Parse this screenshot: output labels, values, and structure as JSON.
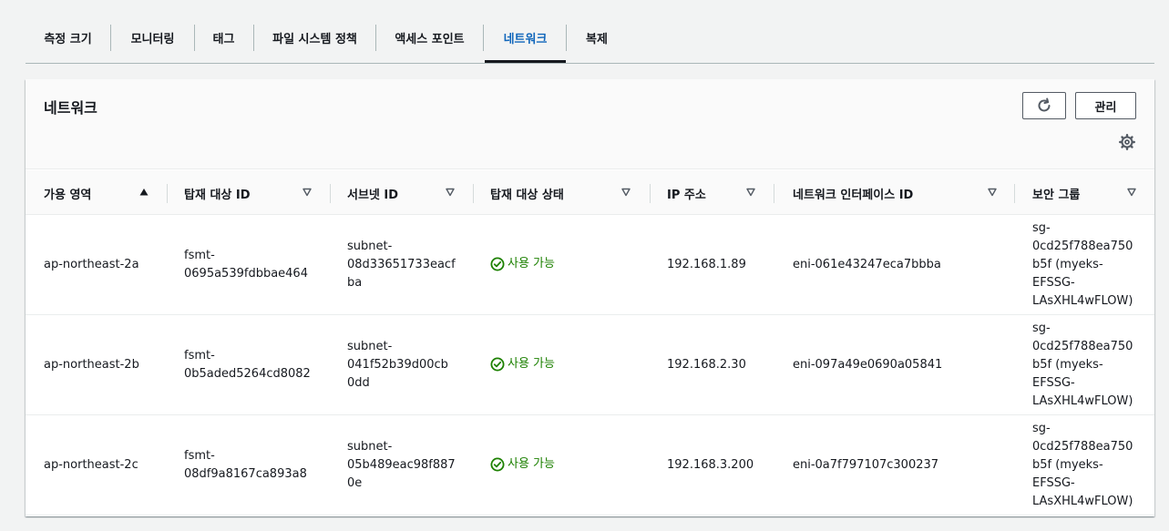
{
  "tabs": [
    {
      "label": "측정 크기"
    },
    {
      "label": "모니터링"
    },
    {
      "label": "태그"
    },
    {
      "label": "파일 시스템 정책"
    },
    {
      "label": "액세스 포인트"
    },
    {
      "label": "네트워크"
    },
    {
      "label": "복제"
    }
  ],
  "active_tab": "네트워크",
  "panel": {
    "title": "네트워크",
    "manage_label": "관리"
  },
  "columns": [
    {
      "label": "가용 영역",
      "sort": "ascending"
    },
    {
      "label": "탑재 대상 ID",
      "sort": "none"
    },
    {
      "label": "서브넷 ID",
      "sort": "none"
    },
    {
      "label": "탑재 대상 상태",
      "sort": "none"
    },
    {
      "label": "IP 주소",
      "sort": "none"
    },
    {
      "label": "네트워크 인터페이스 ID",
      "sort": "none"
    },
    {
      "label": "보안 그룹",
      "sort": "none"
    }
  ],
  "rows": [
    {
      "az": "ap-northeast-2a",
      "mount_id_lines": [
        "fsmt-",
        "0695a539fdbbae464"
      ],
      "subnet_lines": [
        "subnet-",
        "08d33651733eacf",
        "ba"
      ],
      "status": "사용 가능",
      "ip": "192.168.1.89",
      "eni": "eni-061e43247eca7bbba",
      "sg_lines": [
        "sg-",
        "0cd25f788ea750",
        "b5f (myeks-",
        "EFSSG-",
        "LAsXHL4wFLOW)"
      ]
    },
    {
      "az": "ap-northeast-2b",
      "mount_id_lines": [
        "fsmt-",
        "0b5aded5264cd8082"
      ],
      "subnet_lines": [
        "subnet-",
        "041f52b39d00cb",
        "0dd"
      ],
      "status": "사용 가능",
      "ip": "192.168.2.30",
      "eni": "eni-097a49e0690a05841",
      "sg_lines": [
        "sg-",
        "0cd25f788ea750",
        "b5f (myeks-",
        "EFSSG-",
        "LAsXHL4wFLOW)"
      ]
    },
    {
      "az": "ap-northeast-2c",
      "mount_id_lines": [
        "fsmt-",
        "08df9a8167ca893a8"
      ],
      "subnet_lines": [
        "subnet-",
        "05b489eac98f887",
        "0e"
      ],
      "status": "사용 가능",
      "ip": "192.168.3.200",
      "eni": "eni-0a7f797107c300237",
      "sg_lines": [
        "sg-",
        "0cd25f788ea750",
        "b5f (myeks-",
        "EFSSG-",
        "LAsXHL4wFLOW)"
      ]
    }
  ],
  "colors": {
    "accent": "#1066bb",
    "success": "#1d8102",
    "text": "#16191f"
  }
}
